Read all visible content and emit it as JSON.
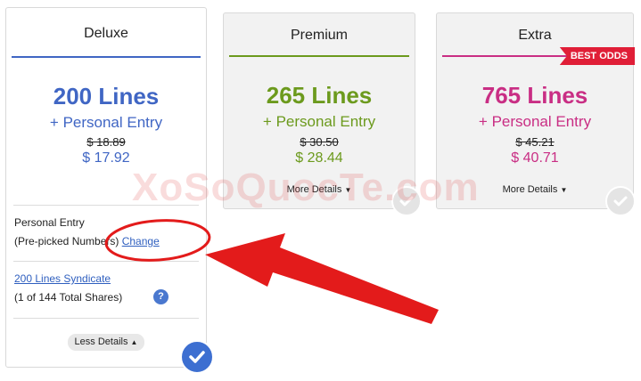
{
  "colors": {
    "deluxe": "#4066c4",
    "premium": "#6c9a1d",
    "extra": "#c92e84",
    "link": "#2f5fbf",
    "badge": "#e01e37",
    "arrow": "#e31b1b"
  },
  "cards": [
    {
      "name": "Deluxe",
      "lines": "200 Lines",
      "entry": "+ Personal Entry",
      "old_price": "$ 18.89",
      "price": "$ 17.92",
      "details_toggle": "Less Details",
      "selected": true
    },
    {
      "name": "Premium",
      "lines": "265 Lines",
      "entry": "+ Personal Entry",
      "old_price": "$ 30.50",
      "price": "$ 28.44",
      "details_toggle": "More Details",
      "selected": false
    },
    {
      "name": "Extra",
      "badge": "BEST ODDS",
      "lines": "765 Lines",
      "entry": "+ Personal Entry",
      "old_price": "$ 45.21",
      "price": "$ 40.71",
      "details_toggle": "More Details",
      "selected": false
    }
  ],
  "deluxe_details": {
    "personal_entry_label": "Personal Entry",
    "prepicked_label": "(Pre-picked Numbers)",
    "change_link": "Change",
    "syndicate_link": "200 Lines Syndicate",
    "shares_text": "(1 of 144 Total Shares)",
    "help_icon": "?"
  },
  "watermark": "XoSoQuocTe.com",
  "icons": {
    "check": "check-icon",
    "caret_up": "caret-up-icon",
    "caret_down": "caret-down-icon"
  }
}
